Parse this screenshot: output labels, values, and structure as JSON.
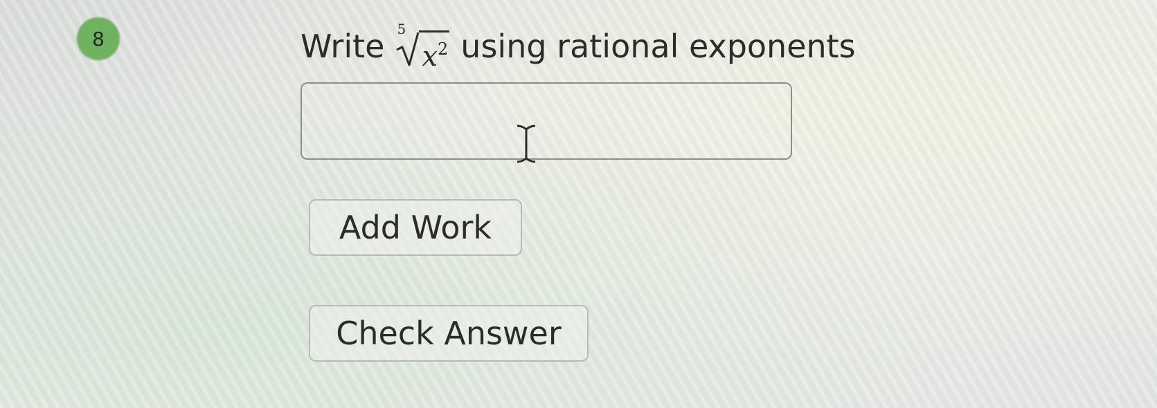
{
  "question": {
    "number": "8",
    "prompt_prefix": "Write",
    "radical_index": "5",
    "radicand_base": "x",
    "radicand_exponent": "2",
    "prompt_suffix": "using rational exponents"
  },
  "answer_input": {
    "value": "",
    "placeholder": ""
  },
  "buttons": {
    "add_work": "Add Work",
    "check_answer": "Check Answer"
  },
  "colors": {
    "badge": "#6fb361",
    "text": "#2b2b2b",
    "input_border": "#8d8f8c"
  },
  "icons": {
    "cursor": "text-cursor-icon"
  }
}
